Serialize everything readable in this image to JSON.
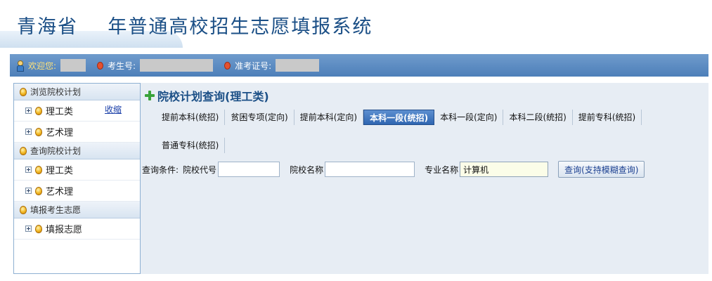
{
  "header": {
    "title": "青海省    年普通高校招生志愿填报系统"
  },
  "info_bar": {
    "welcome_label": "欢迎您:",
    "exam_no_label": "考生号:",
    "ticket_no_label": "准考证号:"
  },
  "sidebar": {
    "collapse_label": "收缩",
    "groups": [
      {
        "label": "浏览院校计划",
        "items": [
          {
            "label": "理工类"
          },
          {
            "label": "艺术理"
          }
        ]
      },
      {
        "label": "查询院校计划",
        "items": [
          {
            "label": "理工类"
          },
          {
            "label": "艺术理"
          }
        ]
      },
      {
        "label": "填报考生志愿",
        "items": [
          {
            "label": "填报志愿"
          }
        ]
      }
    ]
  },
  "main": {
    "heading": "院校计划查询(理工类)",
    "tabs_row1": [
      {
        "label": "提前本科(统招)"
      },
      {
        "label": "贫困专项(定向)"
      },
      {
        "label": "提前本科(定向)"
      },
      {
        "label": "本科一段(统招)",
        "active": true
      },
      {
        "label": "本科一段(定向)"
      },
      {
        "label": "本科二段(统招)"
      },
      {
        "label": "提前专科(统招)"
      }
    ],
    "tabs_row2": [
      {
        "label": "普通专科(统招)"
      }
    ],
    "query": {
      "conditions_label": "查询条件:",
      "school_code_label": "院校代号",
      "school_code_value": "",
      "school_name_label": "院校名称",
      "school_name_value": "",
      "major_name_label": "专业名称",
      "major_name_value": "计算机",
      "button_label": "查询(支持模糊查询)"
    }
  },
  "colors": {
    "title_blue": "#1b4f86",
    "bar_blue": "#4d7fb9",
    "active_tab": "#2f66b1",
    "content_bg": "#e7edf4"
  }
}
